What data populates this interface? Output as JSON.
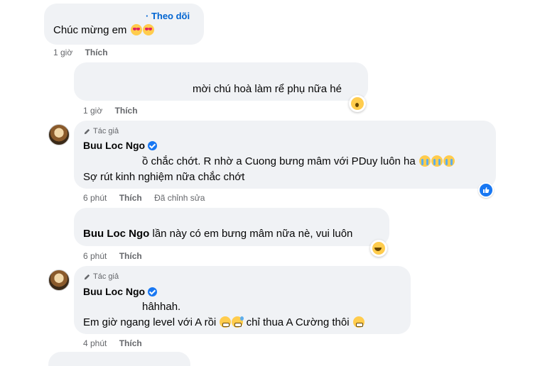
{
  "comments": [
    {
      "follow_label": "· Theo dõi",
      "text": "Chúc mừng em",
      "time": "1 giờ",
      "like_label": "Thích"
    },
    {
      "text": "mời chú hoà làm rể phụ nữa hé",
      "time": "1 giờ",
      "like_label": "Thích"
    },
    {
      "author_badge": "Tác giả",
      "name": "Buu Loc Ngo",
      "line1": "ồ chắc chớt. R nhờ a Cuong bưng mâm với PDuy luôn ha",
      "line2": "Sợ rút kinh nghiệm nữa chắc chớt",
      "time": "6 phút",
      "like_label": "Thích",
      "edited_label": "Đã chỉnh sửa"
    },
    {
      "mention": "Buu Loc Ngo",
      "text": "lần này có em bưng mâm nữa nè, vui luôn",
      "time": "6 phút",
      "like_label": "Thích"
    },
    {
      "author_badge": "Tác giả",
      "name": "Buu Loc Ngo",
      "line1": "hâhhah.",
      "line2": "Em giờ ngang level với A rồi",
      "line2b": "chỉ thua A Cường thôi",
      "time": "4 phút",
      "like_label": "Thích"
    }
  ],
  "icons": {
    "emoji_heart_eyes": "heart-eyes-emoji",
    "emoji_surprised": "surprised-emoji",
    "emoji_crying": "crying-emoji",
    "emoji_grin": "grin-emoji",
    "emoji_hush": "hushed-emoji",
    "like_reaction": "like-icon",
    "author_pen": "pen-icon"
  },
  "colors": {
    "bubble": "#f0f2f5",
    "link": "#0064d1",
    "meta": "#65676b",
    "like": "#1877f2"
  }
}
